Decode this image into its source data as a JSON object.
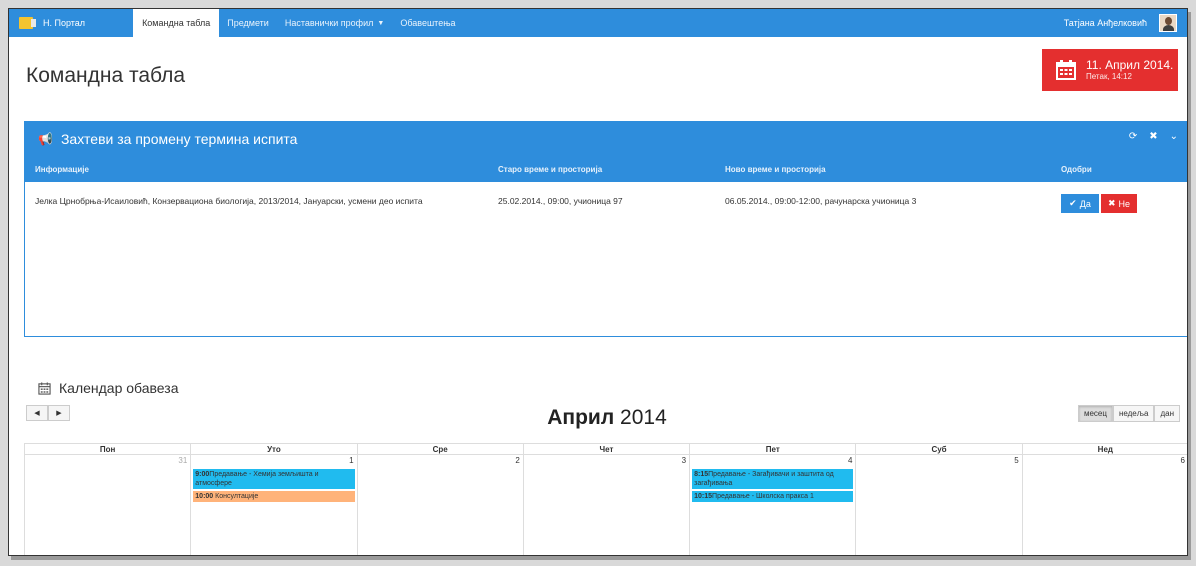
{
  "navbar": {
    "brand": "Н. Портал",
    "items": [
      {
        "label": "Командна табла"
      },
      {
        "label": "Предмети"
      },
      {
        "label": "Наставнички профил"
      },
      {
        "label": "Обавештења"
      }
    ],
    "user_name": "Татјана Анђелковић"
  },
  "page": {
    "title": "Командна табла",
    "date_main": "11. Април 2014.",
    "date_sub": "Петак, 14:12"
  },
  "requests_panel": {
    "title": "Захтеви за промену термина испита",
    "columns": [
      "Информације",
      "Старо време и просторија",
      "Ново време и просторија",
      "Одобри"
    ],
    "rows": [
      {
        "info": "Јелка Црнобрња-Исаиловић, Конзервациона биологија, 2013/2014, Јануарски, усмени део испита",
        "old": "25.02.2014., 09:00, учионица 97",
        "new": "06.05.2014., 09:00-12:00, рачунарска учионица 3",
        "approve": "Да",
        "reject": "Не"
      }
    ]
  },
  "calendar": {
    "title": "Календар обавеза",
    "month": "Април",
    "year": "2014",
    "views": [
      "месец",
      "недеља",
      "дан"
    ],
    "active_view": "месец",
    "weekdays": [
      "Пон",
      "Уто",
      "Сре",
      "Чет",
      "Пет",
      "Суб",
      "Нед"
    ],
    "days": [
      "31",
      "1",
      "2",
      "3",
      "4",
      "5",
      "6"
    ],
    "events": {
      "tue_1_time": "9:00",
      "tue_1_text": "Предавање - Хемија земљишта и атмосфере",
      "tue_2_time": "10:00",
      "tue_2_text": "Консултације",
      "fri_1_time": "8:15",
      "fri_1_text": "Предавање - Загађивачи и заштита од загађивања",
      "fri_2_time": "10:15",
      "fri_2_text": "Предавање - Школска пракса 1"
    },
    "colors": {
      "lecture": "#20bbef",
      "consultation": "#ffb37a"
    }
  },
  "colors": {
    "primary": "#2e8ddc",
    "danger": "#e42f2f"
  }
}
